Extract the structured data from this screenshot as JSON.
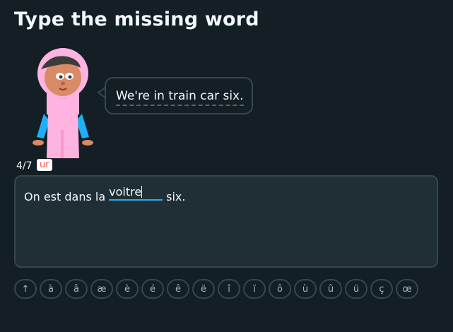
{
  "header": {
    "title": "Type the missing word"
  },
  "prompt": {
    "speech": "We're in train car six."
  },
  "status": {
    "counter": "4/7",
    "hint": "ur"
  },
  "sentence": {
    "before": "On est dans la",
    "typed": "voitre",
    "after": "six."
  },
  "keyboard": {
    "keys": [
      "↑",
      "à",
      "â",
      "æ",
      "è",
      "é",
      "ê",
      "ë",
      "î",
      "ï",
      "ô",
      "ù",
      "û",
      "ü",
      "ç",
      "œ"
    ]
  },
  "colors": {
    "background": "#131f24",
    "accent": "#1cb0f6",
    "border": "#37464f",
    "hint_red": "#ff4b4b",
    "character_pink": "#ffb3e1",
    "character_blue": "#1cb0f6"
  }
}
